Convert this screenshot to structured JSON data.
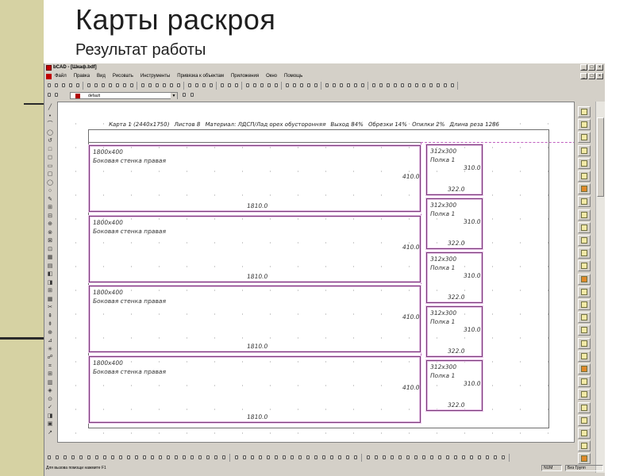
{
  "slide": {
    "title": "Карты раскроя",
    "subtitle": "Результат работы"
  },
  "window": {
    "title": "bCAD - [Шкаф.bdf]",
    "controls": [
      "_",
      "□",
      "×"
    ]
  },
  "menu": {
    "items": [
      "Файл",
      "Правка",
      "Вид",
      "Рисовать",
      "Инструменты",
      "Привязка к объектам",
      "Приложения",
      "Окно",
      "Помощь"
    ]
  },
  "layer_selector": {
    "value": "default",
    "color": "#b00000"
  },
  "drawing": {
    "info_line": [
      "Карта 1 (2440x1750)",
      "Листов 8",
      "Материал: ЛДСП/Лад орех обусторонняя",
      "Выход 84%",
      "Обрезки 14%",
      "Опилки 2%",
      "Длина реза 1286"
    ],
    "parts": [
      {
        "size": "1800x400",
        "name": "Боковая стенка правая",
        "height_dim": "410.0",
        "width_dim": "1810.0"
      },
      {
        "size": "1800x400",
        "name": "Боковая стенка правая",
        "height_dim": "410.0",
        "width_dim": "1810.0"
      },
      {
        "size": "1800x400",
        "name": "Боковая стенка правая",
        "height_dim": "410.0",
        "width_dim": "1810.0"
      },
      {
        "size": "1800x400",
        "name": "Боковая стенка правая",
        "height_dim": "410.0",
        "width_dim": "1810.0"
      }
    ],
    "shelves": [
      {
        "size": "312x300",
        "name": "Полка 1",
        "height_dim": "310.0",
        "width_dim": "322.0"
      },
      {
        "size": "312x300",
        "name": "Полка 1",
        "height_dim": "310.0",
        "width_dim": "322.0"
      },
      {
        "size": "312x300",
        "name": "Полка 1",
        "height_dim": "310.0",
        "width_dim": "322.0"
      },
      {
        "size": "312x300",
        "name": "Полка 1",
        "height_dim": "310.0",
        "width_dim": "322.0"
      },
      {
        "size": "312x300",
        "name": "Полка 1",
        "height_dim": "310.0",
        "width_dim": "322.0"
      }
    ]
  },
  "status": {
    "hint": "Для вызова помощи нажмите F1",
    "num": "NUM",
    "group": "Без Групп"
  },
  "colors": {
    "slide_sidebar": "#d6d2a3",
    "window_face": "#d4d0c8",
    "part_outline": "#7a3a7a"
  }
}
